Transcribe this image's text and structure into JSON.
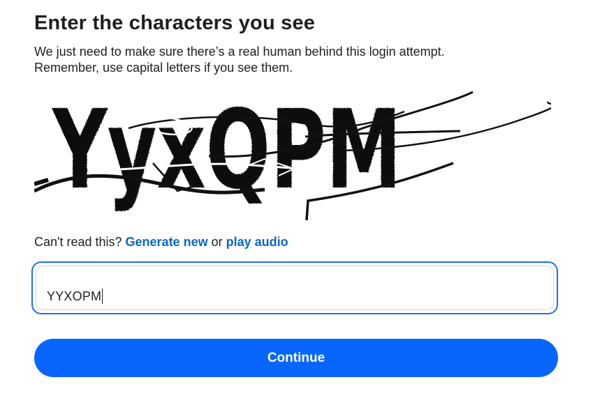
{
  "header": {
    "title": "Enter the characters you see"
  },
  "description": {
    "line1": "We just need to make sure there’s a real human behind this login attempt.",
    "line2": "Remember, use capital letters if you see them."
  },
  "captcha": {
    "text": "YyxQPM"
  },
  "help": {
    "prefix": "Can't read this?",
    "generate_label": "Generate new",
    "or_text": "or",
    "audio_label": "play audio"
  },
  "input": {
    "value": "YYXOPM"
  },
  "actions": {
    "continue_label": "Continue"
  },
  "colors": {
    "link": "#0a66c8",
    "button": "#0866ff",
    "focus_border": "#1b74e4"
  }
}
